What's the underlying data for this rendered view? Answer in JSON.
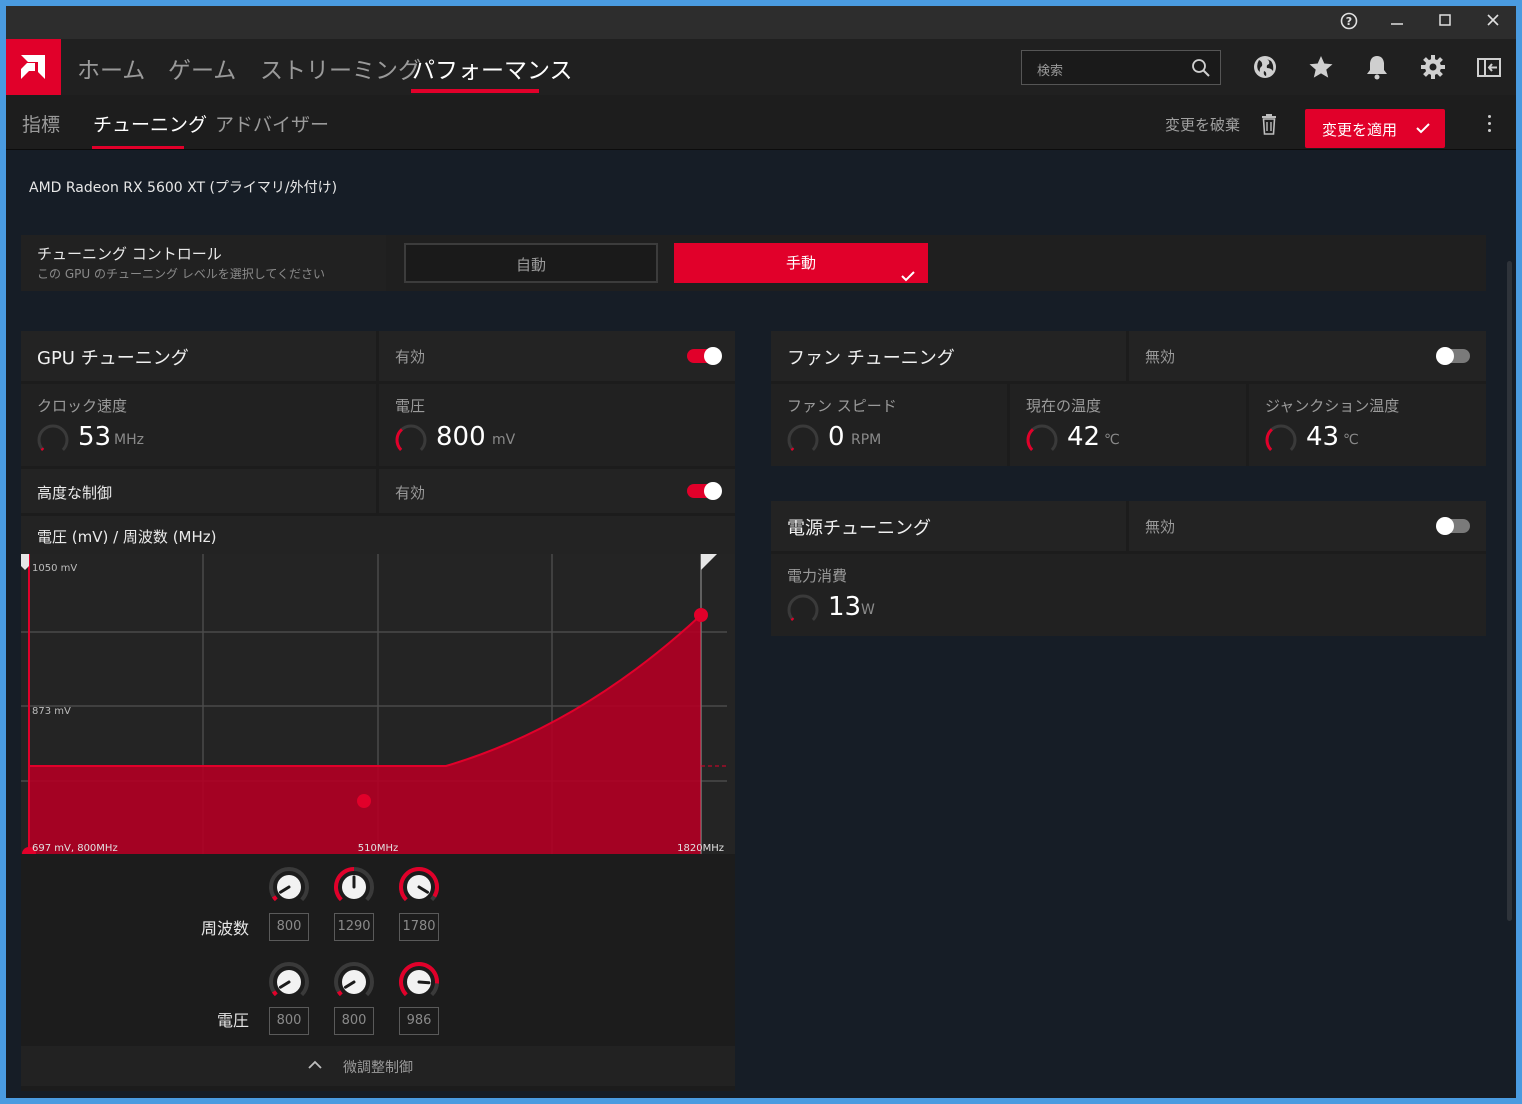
{
  "window": {
    "help_icon": "help-icon",
    "minimize_icon": "minimize-icon",
    "maximize_icon": "maximize-icon",
    "close_icon": "close-icon"
  },
  "topnav": {
    "items": [
      {
        "label": "ホーム",
        "active": false
      },
      {
        "label": "ゲーム",
        "active": false
      },
      {
        "label": "ストリーミング",
        "active": false
      },
      {
        "label": "パフォーマンス",
        "active": true
      }
    ],
    "search_placeholder": "検索"
  },
  "subnav": {
    "items": [
      {
        "label": "指標",
        "active": false
      },
      {
        "label": "チューニング",
        "active": true
      },
      {
        "label": "アドバイザー",
        "active": false
      }
    ],
    "discard_label": "変更を破棄",
    "apply_label": "変更を適用"
  },
  "gpu_name": "AMD Radeon RX 5600 XT (プライマリ/外付け)",
  "tuning_control": {
    "title": "チューニング コントロール",
    "subtitle": "この GPU のチューニング レベルを選択してください",
    "auto_label": "自動",
    "manual_label": "手動",
    "selected": "手動"
  },
  "gpu_tuning": {
    "title": "GPU チューニング",
    "status": "有効",
    "enabled": true,
    "clock": {
      "label": "クロック速度",
      "value": "53",
      "unit": "MHz",
      "fraction": 0.03
    },
    "voltage": {
      "label": "電圧",
      "value": "800",
      "unit": "mV",
      "fraction": 0.35
    },
    "advanced": {
      "label": "高度な制御",
      "status": "有効",
      "enabled": true
    },
    "curve_title": "電圧 (mV) / 周波数 (MHz)"
  },
  "fan_tuning": {
    "title": "ファン チューニング",
    "status": "無効",
    "enabled": false,
    "fan_speed": {
      "label": "ファン スピード",
      "value": "0",
      "unit": "RPM",
      "fraction": 0.0
    },
    "current_temp": {
      "label": "現在の温度",
      "value": "42",
      "unit": "℃",
      "fraction": 0.35
    },
    "junction_temp": {
      "label": "ジャンクション温度",
      "value": "43",
      "unit": "℃",
      "fraction": 0.35
    }
  },
  "power_tuning": {
    "title": "電源チューニング",
    "status": "無効",
    "enabled": false,
    "power": {
      "label": "電力消費",
      "value": "13",
      "unit": "W",
      "fraction": 0.03
    }
  },
  "chart_data": {
    "type": "area",
    "ytick_labels": [
      "1050 mV",
      "873 mV"
    ],
    "xtick_labels": [
      "697 mV, 800MHz",
      "510MHz",
      "1820MHz"
    ],
    "grid": true,
    "accent": "#e1002a",
    "points": [
      {
        "freq": 800,
        "mv": 800
      },
      {
        "freq": 1290,
        "mv": 800
      },
      {
        "freq": 1780,
        "mv": 986
      }
    ]
  },
  "knobs": {
    "frequency_label": "周波数",
    "voltage_label": "電圧",
    "frequency": [
      {
        "value": "800",
        "fraction": 0.05
      },
      {
        "value": "1290",
        "fraction": 0.5
      },
      {
        "value": "1780",
        "fraction": 0.95
      }
    ],
    "voltage": [
      {
        "value": "800",
        "fraction": 0.05
      },
      {
        "value": "800",
        "fraction": 0.05
      },
      {
        "value": "986",
        "fraction": 0.85
      }
    ]
  },
  "footer": {
    "label": "微調整制御"
  },
  "colors": {
    "accent": "#e1002a",
    "panel": "#1f1f1f",
    "background": "#161d26"
  }
}
